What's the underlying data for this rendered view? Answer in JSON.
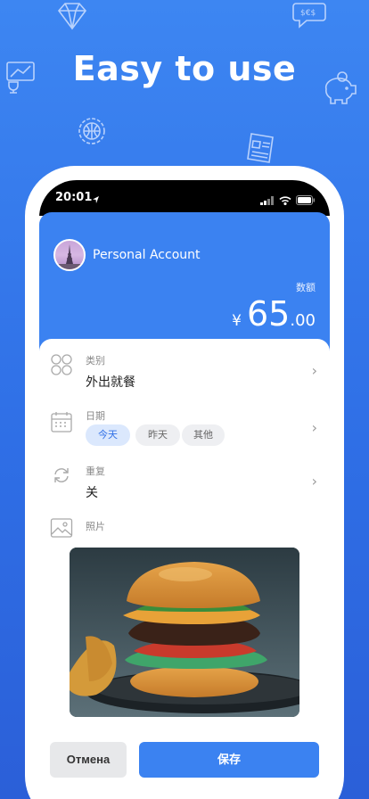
{
  "headline": "Easy to use",
  "status": {
    "time": "20:01"
  },
  "account": {
    "name": "Personal Account"
  },
  "amount": {
    "label": "数额",
    "currency": "¥",
    "integer": "65",
    "decimal": ".00"
  },
  "category": {
    "label": "类别",
    "value": "外出就餐"
  },
  "date": {
    "label": "日期",
    "chips": [
      "今天",
      "昨天",
      "其他"
    ],
    "selected": "今天"
  },
  "repeat": {
    "label": "重复",
    "value": "关"
  },
  "photo": {
    "label": "照片"
  },
  "buttons": {
    "cancel": "Отмена",
    "save": "保存"
  },
  "colors": {
    "primary": "#3b82f1",
    "background": "#2f6fe6",
    "chip_active": "#dbe8fd"
  },
  "icons": [
    "diamond-icon",
    "currency-bubble-icon",
    "trophy-chart-icon",
    "piggy-bank-icon",
    "globe-gear-icon",
    "newspaper-icon",
    "navigation-arrow-icon",
    "signal-icon",
    "wifi-icon",
    "battery-icon",
    "category-grid-icon",
    "calendar-icon",
    "repeat-icon",
    "image-icon",
    "chevron-right-icon"
  ]
}
